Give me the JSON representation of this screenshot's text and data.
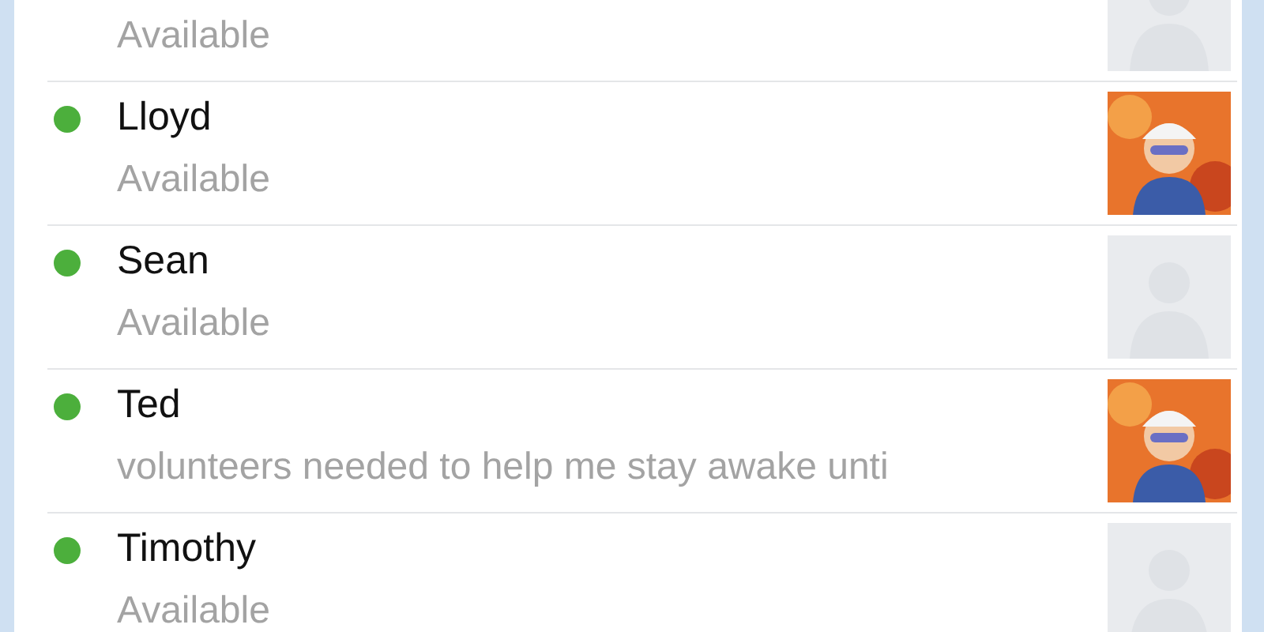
{
  "contacts": [
    {
      "status": "Available",
      "avatar": {
        "kind": "default"
      }
    },
    {
      "name": "Lloyd",
      "status": "Available",
      "color": "#4caf3c"
    },
    {
      "name": "Sean",
      "status": "Available",
      "color": "#4caf3c",
      "avatar": {
        "kind": "default"
      }
    },
    {
      "name": "Ted",
      "status": "volunteers needed to help me stay awake unti",
      "color": "#4caf3c"
    },
    {
      "name": "Timothy",
      "status": "Available",
      "color": "#4caf3c",
      "avatar": {
        "kind": "default"
      }
    }
  ]
}
